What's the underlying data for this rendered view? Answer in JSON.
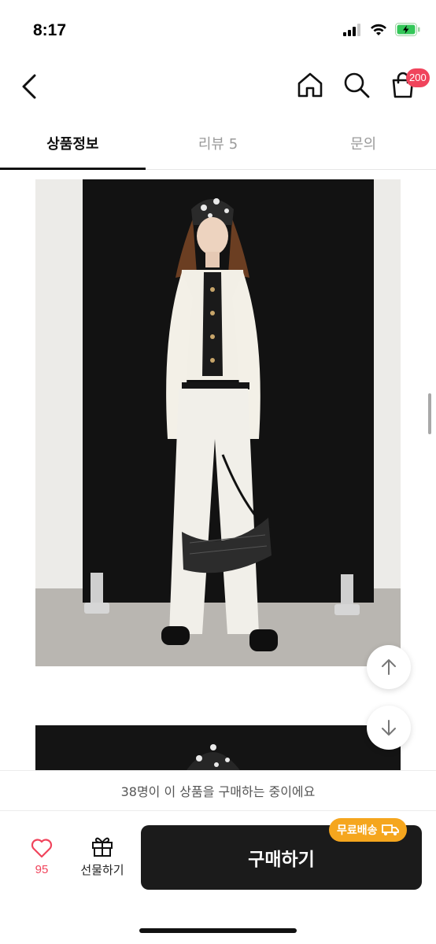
{
  "status": {
    "time": "8:17"
  },
  "header": {
    "cart_badge": "200"
  },
  "tabs": [
    {
      "label": "상품정보",
      "active": true
    },
    {
      "label": "리뷰 5",
      "active": false
    },
    {
      "label": "문의",
      "active": false
    }
  ],
  "notice": {
    "text": "38명이 이 상품을 구매하는 중이에요"
  },
  "bottom": {
    "like_count": "95",
    "gift_label": "선물하기",
    "buy_label": "구매하기",
    "free_shipping_label": "무료배송"
  },
  "colors": {
    "badge": "#f0445c",
    "accent_orange": "#f5a61e",
    "buy_button": "#1b1b1b"
  },
  "icons": [
    "back-icon",
    "home-icon",
    "search-icon",
    "cart-icon",
    "arrow-up-icon",
    "arrow-down-icon",
    "heart-icon",
    "gift-icon",
    "truck-icon"
  ]
}
